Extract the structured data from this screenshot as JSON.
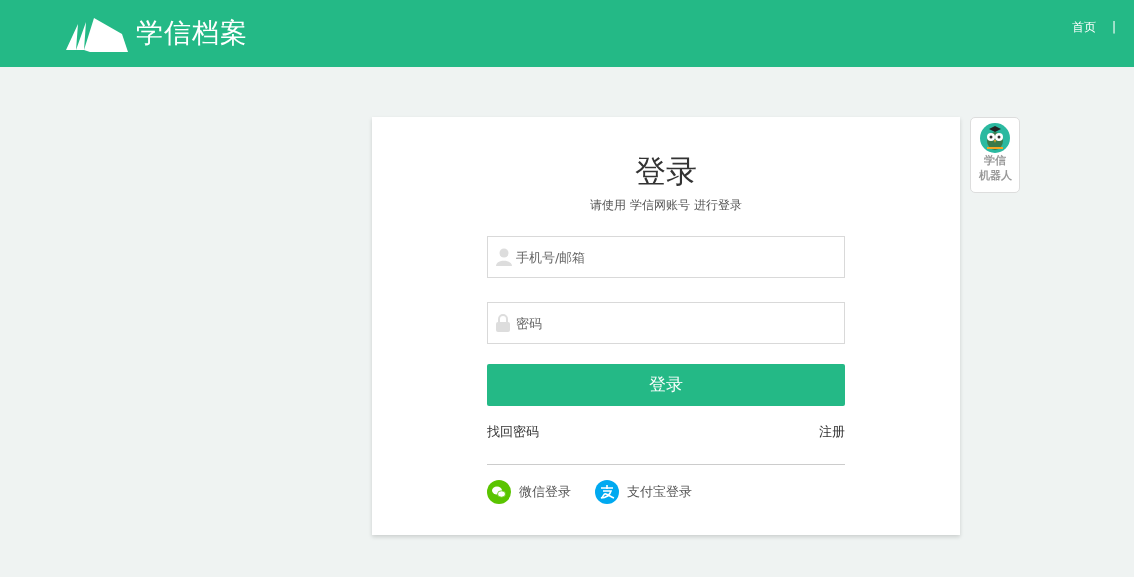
{
  "header": {
    "brand": "学信档案",
    "nav": [
      {
        "label": "首页"
      },
      {
        "label": "|"
      }
    ]
  },
  "login": {
    "title": "登录",
    "subtitle": "请使用 学信网账号 进行登录",
    "fields": [
      {
        "kind": "user",
        "placeholder": "手机号/邮箱"
      },
      {
        "kind": "lock",
        "placeholder": "密码"
      }
    ],
    "submit": "登录",
    "forgot": "找回密码",
    "register": "注册",
    "third_party": [
      {
        "kind": "wechat",
        "label": "微信登录"
      },
      {
        "kind": "alipay",
        "label": "支付宝登录"
      }
    ]
  },
  "robot": {
    "label_lines": [
      "学信",
      "机器人"
    ]
  }
}
